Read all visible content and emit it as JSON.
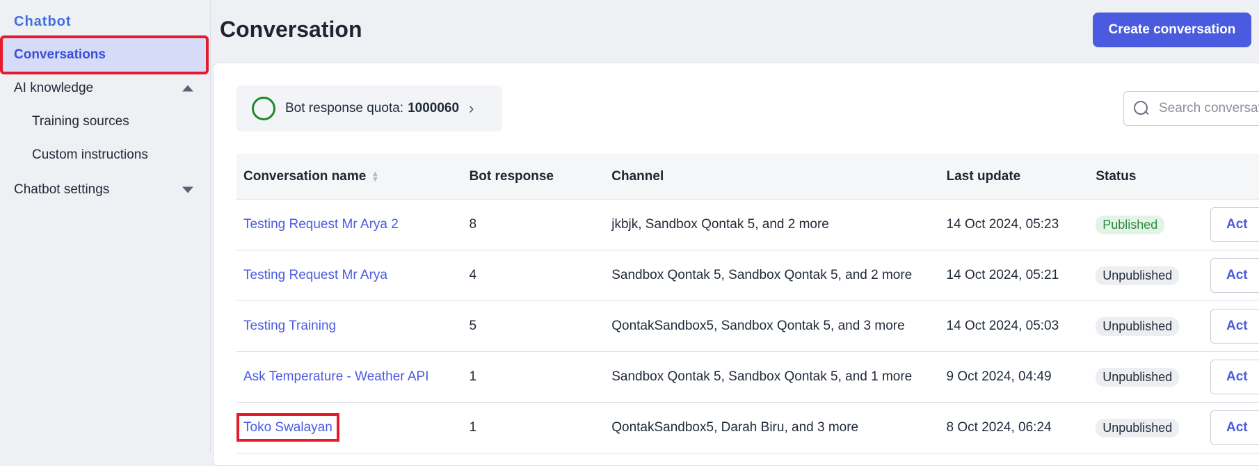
{
  "sidebar": {
    "brand": "Chatbot",
    "items": [
      {
        "label": "Conversations"
      },
      {
        "label": "AI knowledge"
      },
      {
        "label": "Training sources"
      },
      {
        "label": "Custom instructions"
      },
      {
        "label": "Chatbot settings"
      }
    ]
  },
  "header": {
    "title": "Conversation",
    "create_label": "Create conversation"
  },
  "quota": {
    "label": "Bot response quota:",
    "value": "1000060"
  },
  "search": {
    "placeholder": "Search conversation"
  },
  "table": {
    "columns": [
      "Conversation name",
      "Bot response",
      "Channel",
      "Last update",
      "Status"
    ],
    "rows": [
      {
        "name": "Testing Request Mr Arya 2",
        "bot_response": "8",
        "channel": "jkbjk, Sandbox Qontak 5, and 2 more",
        "last_update": "14 Oct 2024, 05:23",
        "status": "Published",
        "action": "Act"
      },
      {
        "name": "Testing Request Mr Arya",
        "bot_response": "4",
        "channel": "Sandbox Qontak 5, Sandbox Qontak 5, and 2 more",
        "last_update": "14 Oct 2024, 05:21",
        "status": "Unpublished",
        "action": "Act"
      },
      {
        "name": "Testing Training",
        "bot_response": "5",
        "channel": "QontakSandbox5, Sandbox Qontak 5, and 3 more",
        "last_update": "14 Oct 2024, 05:03",
        "status": "Unpublished",
        "action": "Act"
      },
      {
        "name": "Ask Temperature - Weather API",
        "bot_response": "1",
        "channel": "Sandbox Qontak 5, Sandbox Qontak 5, and 1 more",
        "last_update": "9 Oct 2024, 04:49",
        "status": "Unpublished",
        "action": "Act"
      },
      {
        "name": "Toko Swalayan",
        "bot_response": "1",
        "channel": "QontakSandbox5, Darah Biru, and 3 more",
        "last_update": "8 Oct 2024, 06:24",
        "status": "Unpublished",
        "action": "Act"
      }
    ]
  },
  "colors": {
    "accent": "#4a5be0",
    "highlight": "#e41b2a",
    "published": "#2e8a3f",
    "quota_ring": "#1d8a2a"
  }
}
